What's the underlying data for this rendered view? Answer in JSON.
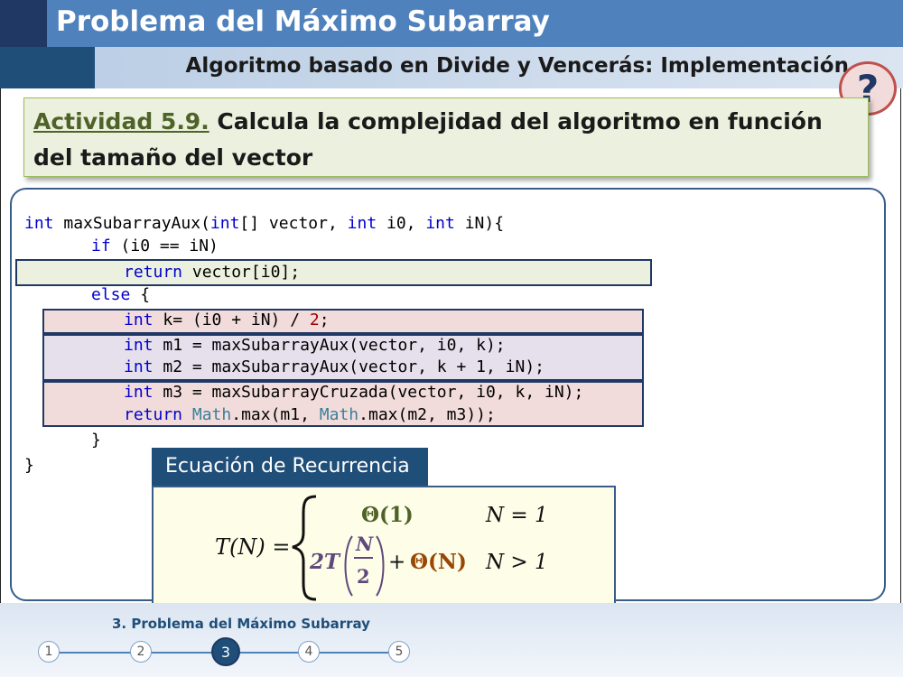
{
  "header": {
    "title": "Problema del Máximo Subarray",
    "subtitle": "Algoritmo basado en Divide y Vencerás: Implementación",
    "help_glyph": "?"
  },
  "activity": {
    "label": "Actividad 5.9.",
    "text": " Calcula la complejidad del algoritmo en función del tamaño del vector"
  },
  "code": {
    "l1_kw": "int",
    "l1_a": " maxSubarrayAux(",
    "l1_kw2": "int",
    "l1_b": "[] vector, ",
    "l1_kw3": "int",
    "l1_c": " i0, ",
    "l1_kw4": "int",
    "l1_d": " iN){",
    "l2_kw": "if",
    "l2_a": " (i0 == iN)",
    "l3_kw": "return",
    "l3_a": " vector[i0];",
    "l4_kw": "else",
    "l4_a": " {",
    "l5_kw": "int",
    "l5_a": " k= (i0 + iN) / ",
    "l5_num": "2",
    "l5_b": ";",
    "l6_kw": "int",
    "l6_a": " m1 = maxSubarrayAux(vector, i0, k);",
    "l7_kw": "int",
    "l7_a": " m2 = maxSubarrayAux(vector, k + 1, iN);",
    "l8_kw": "int",
    "l8_a": " m3 = maxSubarrayCruzada(vector, i0, k, iN);",
    "l9_kw": "return",
    "l9_cls": "Math",
    "l9_a": ".max(m1, ",
    "l9_cls2": "Math",
    "l9_b": ".max(m2, m3));",
    "l10": "}",
    "l11": "}"
  },
  "recurrence": {
    "header": "Ecuación de Recurrencia",
    "lhs": "T(N) =",
    "case1_expr": "Θ(1)",
    "case1_cond": "N = 1",
    "case2_coef": "2T",
    "case2_num": "N",
    "case2_den": "2",
    "case2_plus": "+",
    "case2_theta": "Θ(N)",
    "case2_cond": "N > 1"
  },
  "footer": {
    "section_title": "3. Problema del Máximo Subarray",
    "steps": [
      "1",
      "2",
      "3",
      "4",
      "5"
    ],
    "active_step": "3"
  },
  "colors": {
    "title_band": "#4f81bd",
    "title_dark": "#1f3864",
    "highlight_green": "#ebf1de",
    "highlight_red": "#f2dcdb",
    "highlight_purple": "#e6e0ec",
    "theta1": "#4f6228",
    "theta_n": "#984806",
    "two_t": "#5f497a"
  }
}
